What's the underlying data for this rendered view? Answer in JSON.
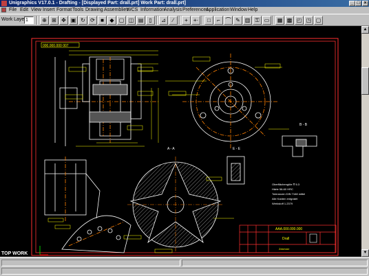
{
  "window": {
    "title": "Unigraphics V17.0.1 - Drafting - [Displayed Part: drall.prt]  Work Part: drall.prt]"
  },
  "menu": {
    "items": [
      "File",
      "Edit",
      "View",
      "Insert",
      "Format",
      "Tools",
      "Drawing",
      "Assemblies",
      "WCS",
      "Information",
      "Analysis",
      "Preferences",
      "Application",
      "Window",
      "Help"
    ]
  },
  "toolbar": {
    "work_layer_label": "Work Layer",
    "work_layer_value": "1"
  },
  "view": {
    "name": "TOP WORK"
  },
  "drawing": {
    "drawing_number": "AAA.000.000.000",
    "part_name": "Drall",
    "sheet_label": "Zeichner",
    "section_aa": "A - A",
    "section_bb": "B - B",
    "section_ee": "E - E",
    "top_label": "000.000.000 007",
    "notes": [
      "Oberflächengüte ∇ 6.3",
      "Härte 58-60 HRC",
      "Toleranzen DIN 7168 mittel",
      "Alle Kanten entgratet",
      "Werkstoff 1.2379"
    ]
  },
  "colors": {
    "background": "#000000",
    "geometry": "#ffffff",
    "dimension": "#ffff00",
    "border": "#ff3030",
    "centerline": "#ff8000",
    "titlebar": "#0a246a"
  }
}
